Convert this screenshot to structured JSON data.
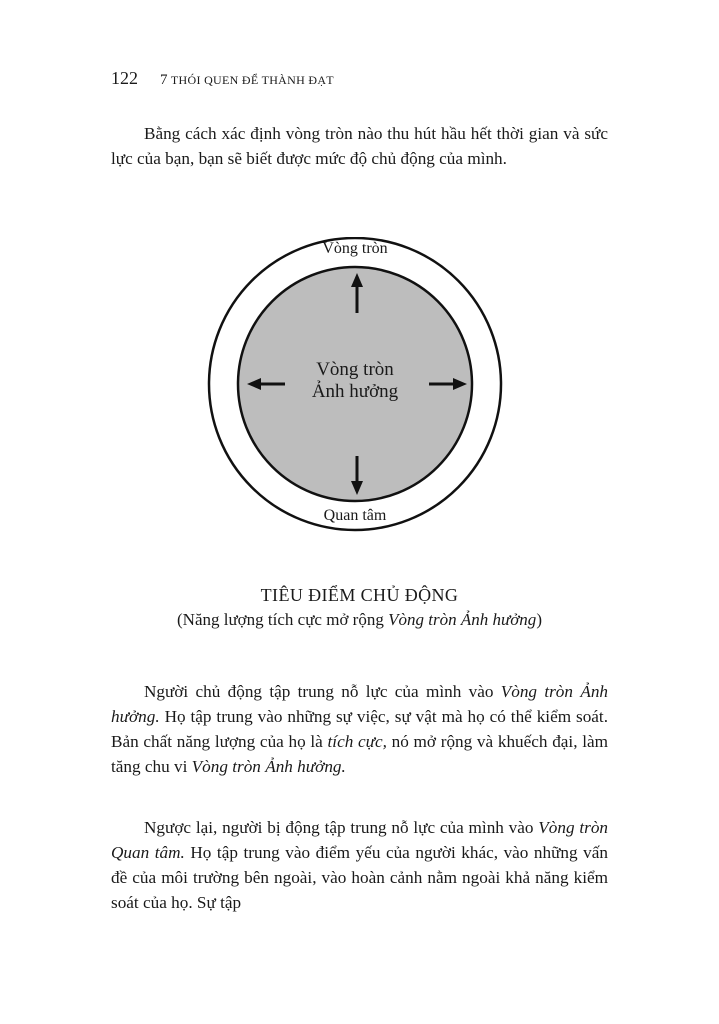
{
  "header": {
    "page_number": "122",
    "running_title_prefix": "7",
    "running_title": "THÓI QUEN ĐỂ THÀNH ĐẠT"
  },
  "intro_paragraph": "Bằng cách xác định vòng tròn nào thu hút hầu hết thời gian và sức lực của bạn, bạn  sẽ biết được mức độ chủ động của mình.",
  "diagram": {
    "outer_label_top": "Vòng tròn",
    "outer_label_bottom": "Quan tâm",
    "inner_label_line1": "Vòng tròn",
    "inner_label_line2": "Ảnh hưởng",
    "inner_fill": "#bdbdbd",
    "stroke": "#111111",
    "arrow_icons": [
      "arrow-up-icon",
      "arrow-down-icon",
      "arrow-left-icon",
      "arrow-right-icon"
    ]
  },
  "caption": {
    "title": "TIÊU ĐIỂM CHỦ ĐỘNG",
    "sub_prefix": "(Năng lượng tích cực mở rộng ",
    "sub_italic": "Vòng tròn Ảnh hưởng",
    "sub_suffix": ")"
  },
  "paragraph2": {
    "t1": "Người chủ động tập trung nỗ lực của mình vào ",
    "i1": "Vòng tròn Ảnh hưởng.",
    "t2": " Họ tập trung vào những sự việc, sự vật mà họ có thể kiểm soát. Bản chất năng lượng của họ là ",
    "i2": "tích cực,",
    "t3": " nó mở rộng và khuếch đại, làm tăng chu vi ",
    "i3": "Vòng tròn Ảnh hưởng."
  },
  "paragraph3": {
    "t1": "Ngược lại, người bị động tập trung nỗ lực của mình vào ",
    "i1": "Vòng tròn Quan tâm.",
    "t2": " Họ tập trung vào điểm yếu của người khác, vào những vấn đề của môi trường bên ngoài, vào hoàn cảnh nằm ngoài khả năng kiểm soát của họ. Sự tập"
  }
}
